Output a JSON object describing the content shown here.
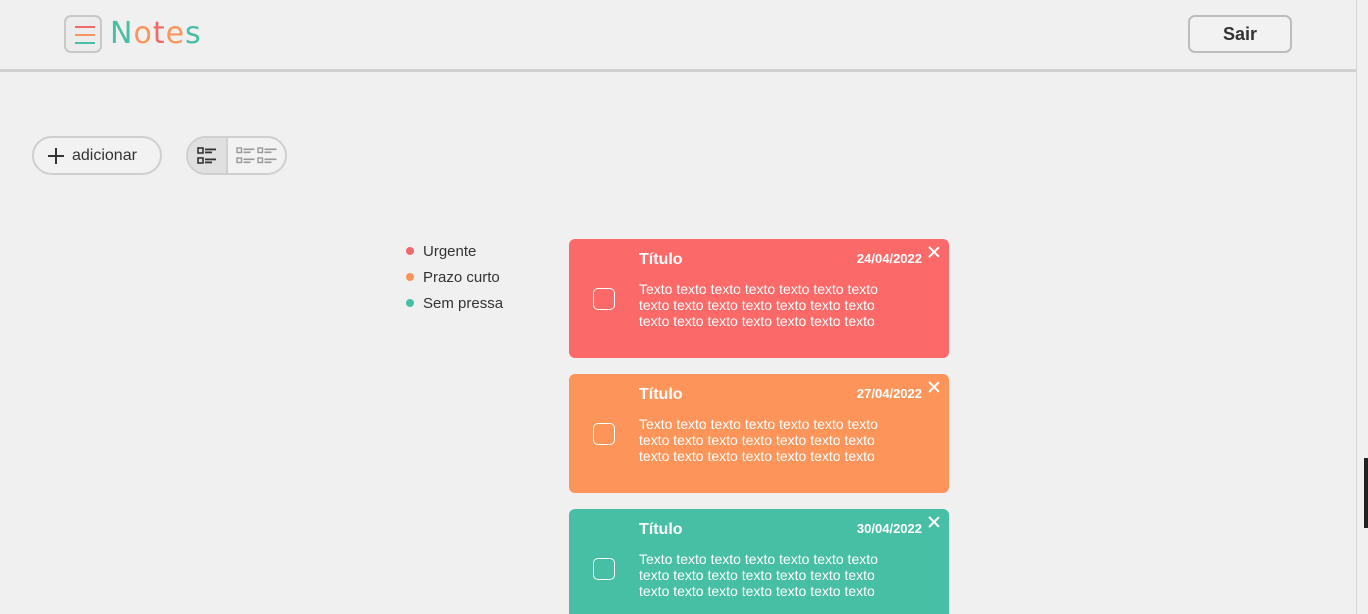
{
  "header": {
    "logo_letters": [
      "N",
      "o",
      "t",
      "e",
      "s"
    ],
    "logo_colors": [
      "#46bfa4",
      "#f9955b",
      "#f06a6a",
      "#f9955b",
      "#46bfa4"
    ],
    "menu_bar_colors": [
      "#f06a6a",
      "#f9955b",
      "#46bfa4"
    ],
    "menu_icon": "hamburger-icon",
    "logout_label": "Sair"
  },
  "toolbar": {
    "add_label": "adicionar",
    "add_icon": "plus-icon",
    "view_modes": [
      {
        "icon": "list-view-icon",
        "active": true
      },
      {
        "icon": "grid-view-icon",
        "active": false
      }
    ]
  },
  "legend": {
    "items": [
      {
        "label": "Urgente",
        "color": "#f06a6a"
      },
      {
        "label": "Prazo curto",
        "color": "#f9955b"
      },
      {
        "label": "Sem pressa",
        "color": "#46bfa4"
      }
    ]
  },
  "notes": [
    {
      "title": "Título",
      "date": "24/04/2022",
      "body": "Texto texto texto texto texto texto texto texto texto texto texto texto texto texto texto texto texto texto texto texto texto",
      "color": "#fc6969"
    },
    {
      "title": "Título",
      "date": "27/04/2022",
      "body": "Texto texto texto texto texto texto texto texto texto texto texto texto texto texto texto texto texto texto texto texto texto",
      "color": "#fd955a"
    },
    {
      "title": "Título",
      "date": "30/04/2022",
      "body": "Texto texto texto texto texto texto texto texto texto texto texto texto texto texto texto texto texto texto texto texto texto",
      "color": "#47bfa4"
    }
  ]
}
